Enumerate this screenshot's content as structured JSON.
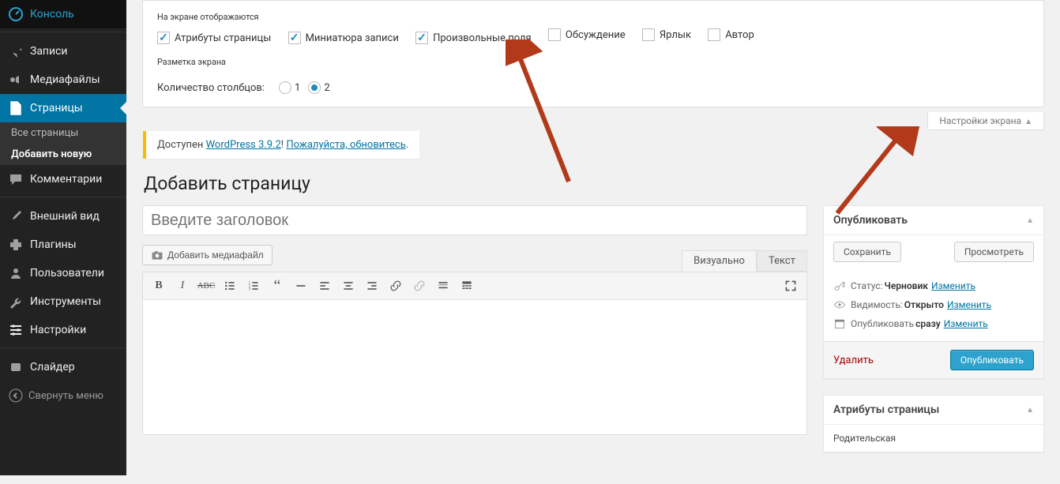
{
  "sidebar": {
    "items": [
      {
        "label": "Консоль",
        "icon": "dashboard"
      },
      {
        "label": "Записи",
        "icon": "pin"
      },
      {
        "label": "Медиафайлы",
        "icon": "media"
      },
      {
        "label": "Страницы",
        "icon": "page",
        "current": true
      },
      {
        "label": "Комментарии",
        "icon": "comment"
      },
      {
        "label": "Внешний вид",
        "icon": "appearance"
      },
      {
        "label": "Плагины",
        "icon": "plugin"
      },
      {
        "label": "Пользователи",
        "icon": "user"
      },
      {
        "label": "Инструменты",
        "icon": "tools"
      },
      {
        "label": "Настройки",
        "icon": "settings"
      },
      {
        "label": "Слайдер",
        "icon": "generic"
      }
    ],
    "pages_submenu": [
      {
        "label": "Все страницы"
      },
      {
        "label": "Добавить новую",
        "current": true
      }
    ],
    "collapse_label": "Свернуть меню"
  },
  "screen_options": {
    "boxes_heading": "На экране отображаются",
    "checkboxes": [
      {
        "label": "Атрибуты страницы",
        "checked": true
      },
      {
        "label": "Миниатюра записи",
        "checked": true
      },
      {
        "label": "Произвольные поля",
        "checked": true
      },
      {
        "label": "Обсуждение",
        "checked": false
      },
      {
        "label": "Ярлык",
        "checked": false
      },
      {
        "label": "Автор",
        "checked": false
      }
    ],
    "layout_heading": "Разметка экрана",
    "columns_label": "Количество столбцов:",
    "columns_options": [
      "1",
      "2"
    ],
    "columns_value": "2",
    "tab_label": "Настройки экрана"
  },
  "update_nag": {
    "prefix": "Доступен ",
    "link1": "WordPress 3.9.2",
    "mid": "! ",
    "link2": "Пожалуйста, обновитесь",
    "suffix": "."
  },
  "page_title": "Добавить страницу",
  "title_placeholder": "Введите заголовок",
  "add_media_label": "Добавить медиафайл",
  "editor_tabs": {
    "visual": "Визуально",
    "text": "Текст"
  },
  "publish": {
    "box_title": "Опубликовать",
    "save_btn": "Сохранить",
    "preview_btn": "Просмотреть",
    "status_label": "Статус:",
    "status_value": "Черновик",
    "visibility_label": "Видимость:",
    "visibility_value": "Открыто",
    "schedule_label": "Опубликовать",
    "schedule_value": "сразу",
    "edit_link": "Изменить",
    "delete_label": "Удалить",
    "publish_btn": "Опубликовать"
  },
  "attributes": {
    "box_title": "Атрибуты страницы",
    "parent_label": "Родительская"
  }
}
